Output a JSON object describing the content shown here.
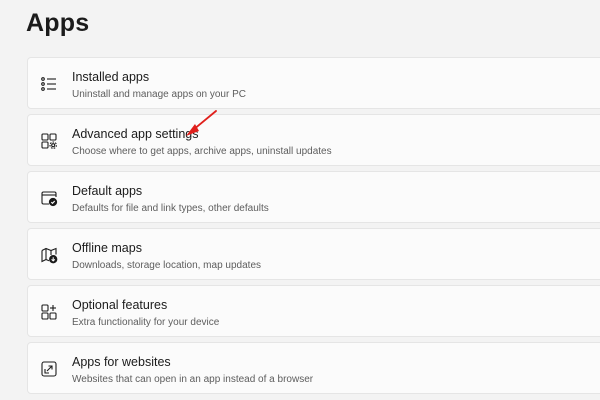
{
  "page": {
    "title": "Apps"
  },
  "items": [
    {
      "title": "Installed apps",
      "subtitle": "Uninstall and manage apps on your PC",
      "icon": "installed-apps-list-icon"
    },
    {
      "title": "Advanced app settings",
      "subtitle": "Choose where to get apps, archive apps, uninstall updates",
      "icon": "advanced-app-settings-icon"
    },
    {
      "title": "Default apps",
      "subtitle": "Defaults for file and link types, other defaults",
      "icon": "default-apps-icon"
    },
    {
      "title": "Offline maps",
      "subtitle": "Downloads, storage location, map updates",
      "icon": "offline-maps-icon"
    },
    {
      "title": "Optional features",
      "subtitle": "Extra functionality for your device",
      "icon": "optional-features-icon"
    },
    {
      "title": "Apps for websites",
      "subtitle": "Websites that can open in an app instead of a browser",
      "icon": "apps-for-websites-icon"
    }
  ],
  "annotation": {
    "arrow_color": "#e0201c"
  }
}
